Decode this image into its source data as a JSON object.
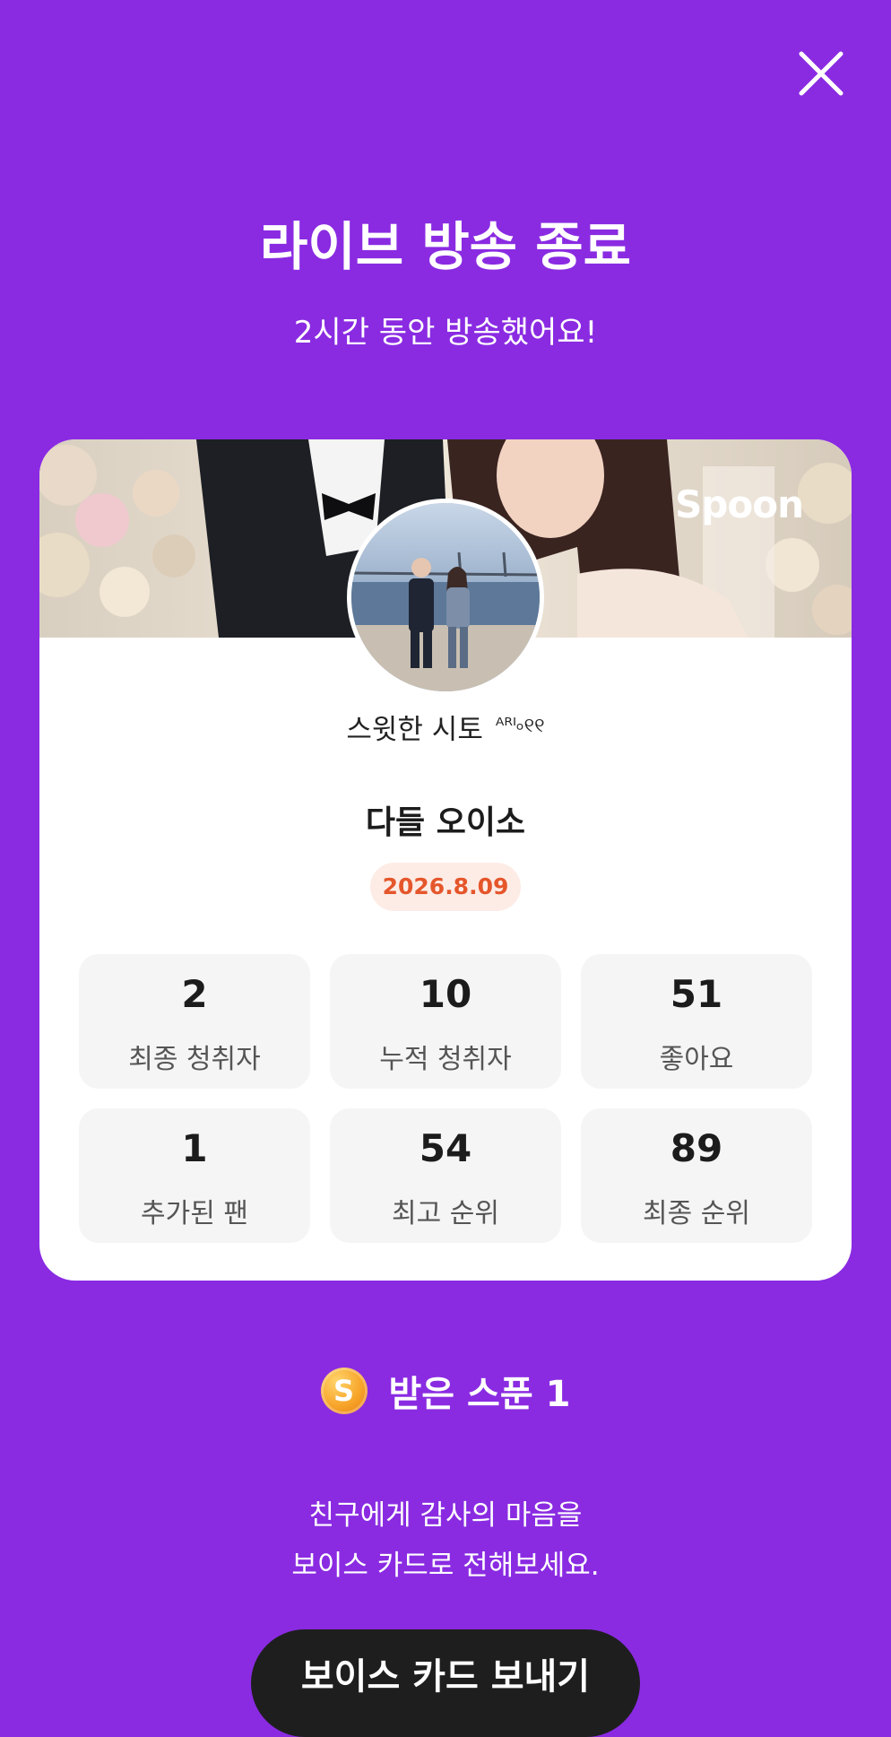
{
  "header": {
    "close_icon": "close-icon",
    "title": "라이브 방송 종료",
    "subtitle": "2시간 동안 방송했어요!"
  },
  "card": {
    "brand": "Spoon",
    "dj_name": "스윗한 시토",
    "dj_name_deco": "ᴬᴿᴵ৹୧୧",
    "room_title": "다들 오이소",
    "date": "2026.8.09",
    "stats": [
      {
        "value": "2",
        "label": "최종 청취자"
      },
      {
        "value": "10",
        "label": "누적 청취자"
      },
      {
        "value": "51",
        "label": "좋아요"
      },
      {
        "value": "1",
        "label": "추가된 팬"
      },
      {
        "value": "54",
        "label": "최고 순위"
      },
      {
        "value": "89",
        "label": "최종 순위"
      }
    ]
  },
  "spoon": {
    "coin_letter": "S",
    "label": "받은 스푼",
    "count": "1"
  },
  "message": {
    "line1": "친구에게 감사의 마음을",
    "line2": "보이스 카드로 전해보세요."
  },
  "cta": {
    "label": "보이스 카드 보내기"
  },
  "colors": {
    "background": "#8a2be2",
    "date_text": "#e5562b",
    "date_bg": "#fdece6",
    "button_bg": "#1e1e1e"
  }
}
